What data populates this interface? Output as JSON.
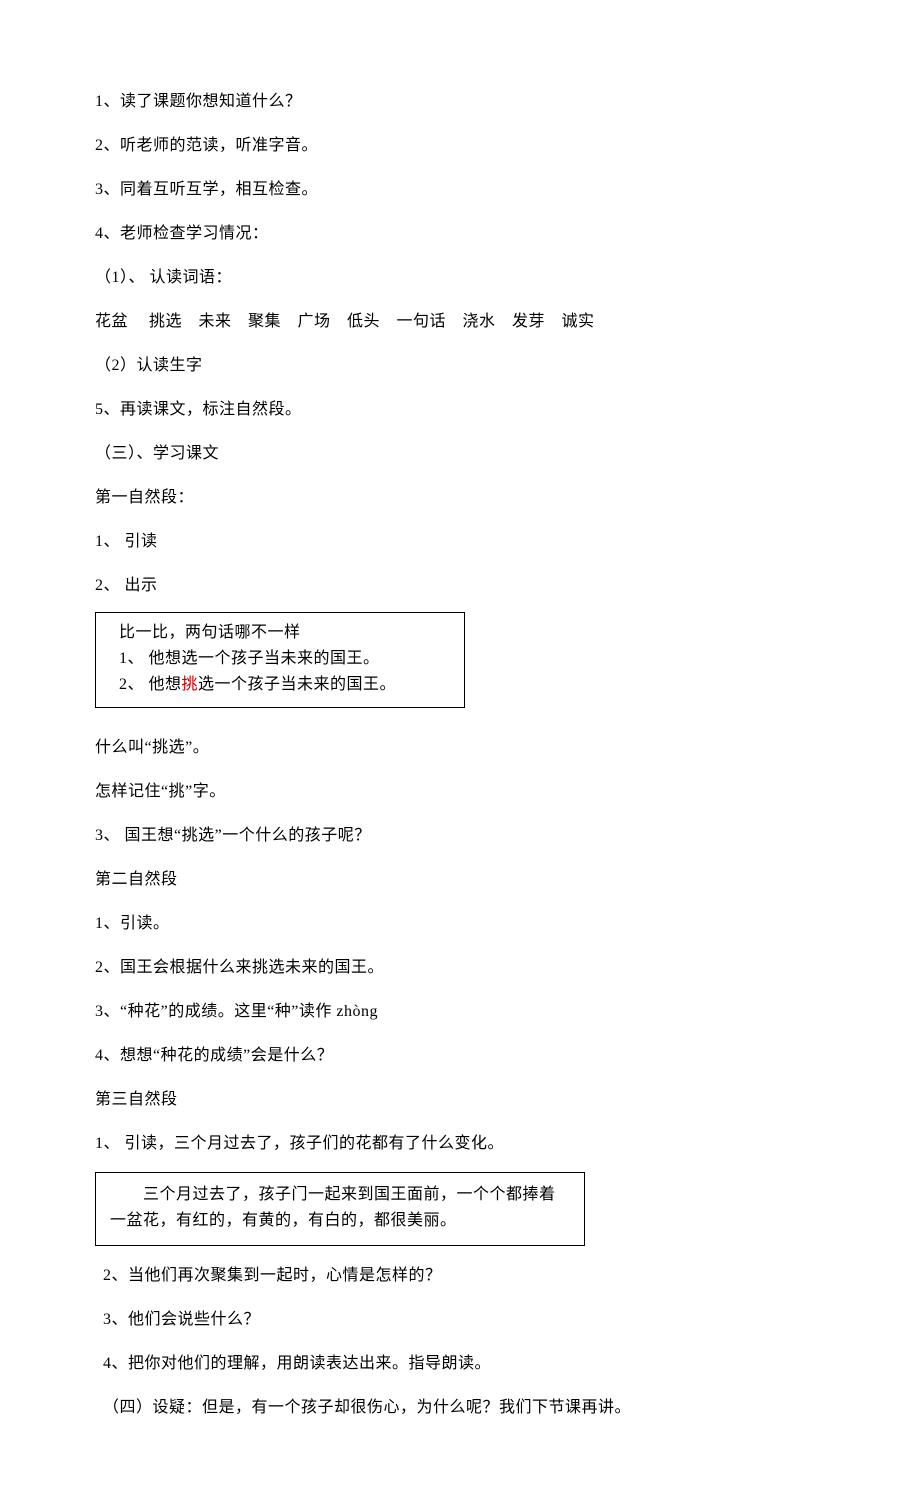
{
  "lines": {
    "l1": "1、读了课题你想知道什么？",
    "l2": "2、听老师的范读，听准字音。",
    "l3": "3、同着互听互学，相互检查。",
    "l4": "4、老师检查学习情况：",
    "l5": "（1）、 认读词语：",
    "l6": "花盆　 挑选　未来　聚集　广场　低头　一句话　浇水　发芽　诚实",
    "l7": "（2）认读生字",
    "l8": "5、再读课文，标注自然段。",
    "l9": "（三）、学习课文",
    "l10": "第一自然段：",
    "l11": "1、 引读",
    "l12": "2、 出示"
  },
  "box1": {
    "b1": "比一比，两句话哪不一样",
    "b2": "1、 他想选一个孩子当未来的国王。",
    "b3_pre": "2、 他想",
    "b3_hi": "挑",
    "b3_post": "选一个孩子当未来的国王。"
  },
  "mid": {
    "m1": "什么叫“挑选”。",
    "m2": "怎样记住“挑”字。",
    "m3": "3、 国王想“挑选”一个什么的孩子呢？",
    "m4": "第二自然段",
    "m5": "1、引读。",
    "m6": "2、国王会根据什么来挑选未来的国王。",
    "m7": "3、“种花”的成绩。这里“种”读作 zhòng",
    "m8": "4、想想“种花的成绩”会是什么？",
    "m9": "第三自然段",
    "m10": "1、 引读，三个月过去了，孩子们的花都有了什么变化。"
  },
  "box2": {
    "c1": "　　三个月过去了，孩子门一起来到国王面前，一个个都捧着",
    "c2": "一盆花，有红的，有黄的，有白的，都很美丽。"
  },
  "tail": {
    "t1": "2、当他们再次聚集到一起时，心情是怎样的？",
    "t2": "3、他们会说些什么？",
    "t3": "4、把你对他们的理解，用朗读表达出来。指导朗读。",
    "t4": "（四）设疑：但是，有一个孩子却很伤心，为什么呢？我们下节课再讲。"
  }
}
